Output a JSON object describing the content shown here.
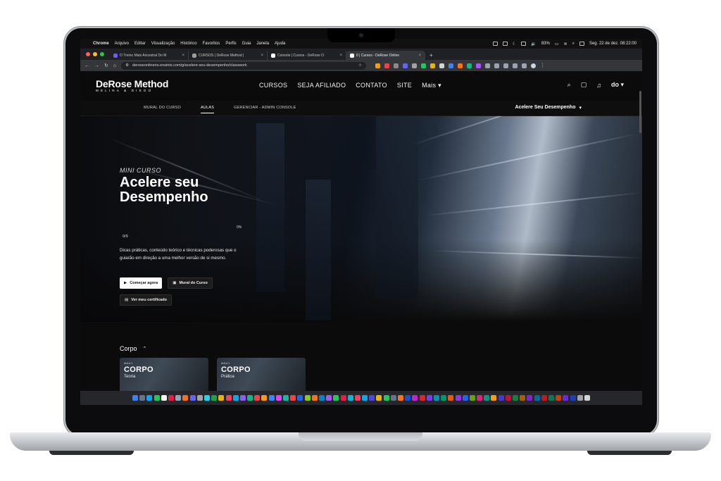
{
  "menubar": {
    "app": "Chrome",
    "menus": [
      "Arquivo",
      "Editar",
      "Visualização",
      "Histórico",
      "Favoritos",
      "Perfis",
      "Guia",
      "Janela",
      "Ajuda"
    ],
    "battery": "83%",
    "datetime": "Seg. 22 de dez. 08:22:00"
  },
  "tabs": [
    {
      "label": "O Treino Mais Ancestral Do M",
      "active": false
    },
    {
      "label": "CURSOS | DeRose Method |",
      "active": false
    },
    {
      "label": "Console | Cursos - DeRose O",
      "active": false
    },
    {
      "label": "0 | Cursos - DeRose Online",
      "active": true
    }
  ],
  "address": {
    "url": "deroseonlinerio.ensinio.com/g/acelere-seu-desempenho/classwork"
  },
  "site": {
    "logo_title": "DeRose Method",
    "logo_sub": "MELINA & DIEGO",
    "nav": [
      "CURSOS",
      "SEJA AFILIADO",
      "CONTATO",
      "SITE",
      "Mais"
    ],
    "user_initials": "do"
  },
  "subnav": {
    "items": [
      "MURAL DO CURSO",
      "AULAS",
      "GERENCIAR - ADMIN CONSOLE"
    ],
    "active_index": 1,
    "course_select": "Acelere Seu Desempenho"
  },
  "hero": {
    "eyebrow": "MINI CURSO",
    "title_line1": "Acelere seu",
    "title_line2": "Desempenho",
    "progress_pct": "0%",
    "progress_count": "0/9",
    "description": "Dicas práticas, conteúdo teórico e técnicas poderosas que o guiarão em direção a uma melhor versão de si mesmo.",
    "btn_start": "Começar agora",
    "btn_wall": "Mural do Curso",
    "btn_certificate": "Ver meu certificado"
  },
  "section": {
    "title": "Corpo",
    "cards": [
      {
        "aula": "AULA 1",
        "title": "CORPO",
        "subtitle": "Teoria"
      },
      {
        "aula": "AULA 1",
        "title": "CORPO",
        "subtitle": "Prática"
      }
    ]
  },
  "colors": {
    "page_bg": "#0b0b0b",
    "accent_white": "#ffffff",
    "chrome_dark": "#202124"
  },
  "dock_icon_colors": [
    "#3b82f6",
    "#64748b",
    "#0ea5e9",
    "#22c55e",
    "#f5f5f5",
    "#e11d48",
    "#94a3b8",
    "#f97316",
    "#6366f1",
    "#a3a3a3",
    "#22d3ee",
    "#16a34a",
    "#eab308",
    "#f43f5e",
    "#0ea5e9",
    "#8b5cf6",
    "#10b981",
    "#ef4444",
    "#f59e0b",
    "#3b82f6",
    "#d946ef",
    "#14b8a6",
    "#ef4444",
    "#2563eb",
    "#84cc16",
    "#f97316",
    "#0284c7",
    "#a855f7",
    "#22c55e",
    "#e11d48",
    "#06b6d4",
    "#f43f5e",
    "#0ea5e9",
    "#4f46e5",
    "#eab308",
    "#22c55e",
    "#64748b",
    "#f97316",
    "#1d4ed8",
    "#c026d3",
    "#dc2626",
    "#7c3aed",
    "#0891b2",
    "#059669",
    "#ea580c",
    "#9333ea",
    "#2563eb",
    "#65a30d",
    "#db2777",
    "#0d9488",
    "#f59e0b",
    "#4338ca",
    "#be123c",
    "#15803d",
    "#a16207",
    "#7e22ce",
    "#0369a1",
    "#b91c1c",
    "#047857",
    "#c2410c",
    "#6d28d9",
    "#1e40af",
    "#a3a3a3",
    "#d4d4d4"
  ]
}
